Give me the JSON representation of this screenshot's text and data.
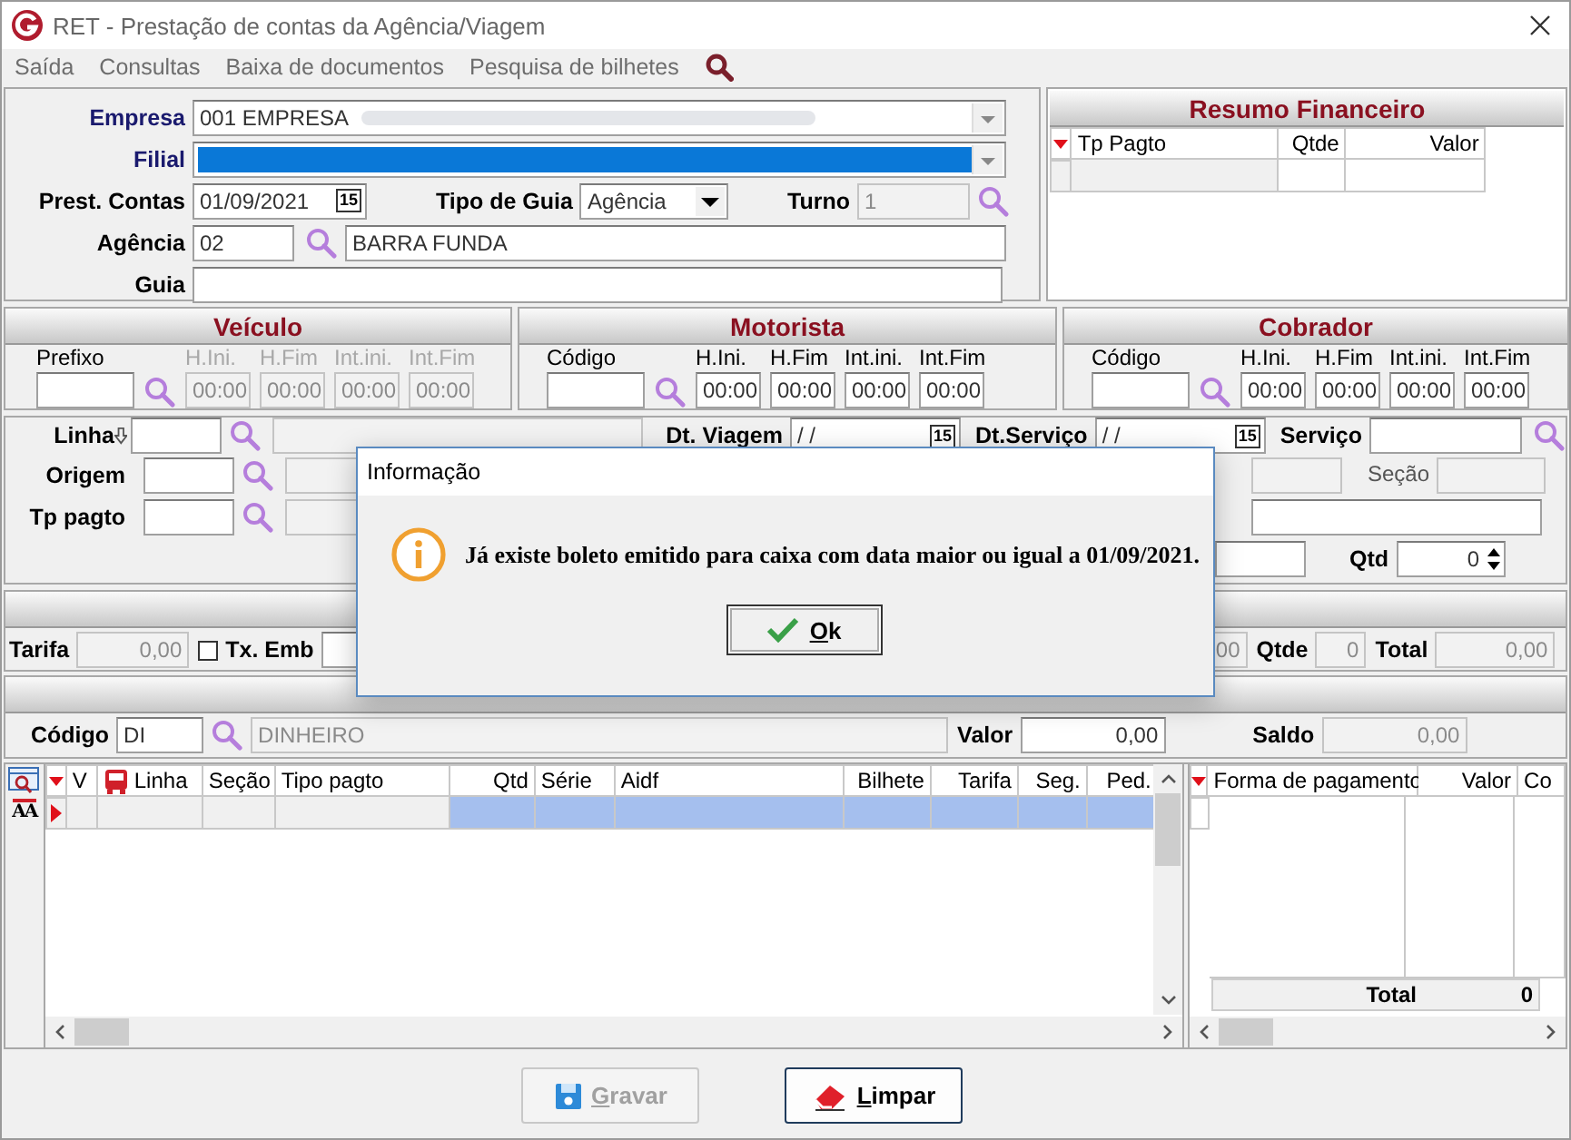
{
  "window": {
    "title": "RET - Prestação de contas da Agência/Viagem"
  },
  "menu": [
    {
      "label": "Saída"
    },
    {
      "label": "Consultas"
    },
    {
      "label": "Baixa de documentos"
    },
    {
      "label": "Pesquisa de bilhetes"
    }
  ],
  "header": {
    "empresa": {
      "label": "Empresa",
      "value": "001 EMPRESA"
    },
    "filial": {
      "label": "Filial",
      "selected": true
    },
    "prest_contas": {
      "label": "Prest. Contas",
      "value": "01/09/2021",
      "icon_text": "15"
    },
    "tipo_guia": {
      "label": "Tipo de Guia",
      "value": "Agência"
    },
    "turno": {
      "label": "Turno",
      "value": "1",
      "disabled": true
    },
    "agencia": {
      "label": "Agência",
      "code": "02",
      "name": "BARRA FUNDA"
    },
    "guia": {
      "label": "Guia"
    }
  },
  "resumo": {
    "title": "Resumo Financeiro",
    "columns": [
      {
        "label": "Tp Pagto"
      },
      {
        "label": "Qtde"
      },
      {
        "label": "Valor"
      }
    ]
  },
  "crew": [
    {
      "title": "Veículo",
      "code_label": "Prefixo",
      "times": [
        {
          "label": "H.Ini.",
          "value": "00:00",
          "disabled": true
        },
        {
          "label": "H.Fim",
          "value": "00:00",
          "disabled": true
        },
        {
          "label": "Int.ini.",
          "value": "00:00",
          "disabled": true
        },
        {
          "label": "Int.Fim",
          "value": "00:00",
          "disabled": true
        }
      ]
    },
    {
      "title": "Motorista",
      "code_label": "Código",
      "times": [
        {
          "label": "H.Ini.",
          "value": "00:00",
          "disabled": false
        },
        {
          "label": "H.Fim",
          "value": "00:00",
          "disabled": false
        },
        {
          "label": "Int.ini.",
          "value": "00:00",
          "disabled": false
        },
        {
          "label": "Int.Fim",
          "value": "00:00",
          "disabled": false
        }
      ]
    },
    {
      "title": "Cobrador",
      "code_label": "Código",
      "times": [
        {
          "label": "H.Ini.",
          "value": "00:00",
          "disabled": false
        },
        {
          "label": "H.Fim",
          "value": "00:00",
          "disabled": false
        },
        {
          "label": "Int.ini.",
          "value": "00:00",
          "disabled": false
        },
        {
          "label": "Int.Fim",
          "value": "00:00",
          "disabled": false
        }
      ]
    }
  ],
  "viagem": {
    "linha": {
      "label": "Linha"
    },
    "dt_viagem": {
      "label": "Dt. Viagem",
      "value": "/ /",
      "icon_text": "15"
    },
    "dt_servico": {
      "label": "Dt.Serviço",
      "value": "/ /",
      "icon_text": "15"
    },
    "servico": {
      "label": "Serviço"
    },
    "origem": {
      "label": "Origem"
    },
    "secao": {
      "label": "Seção"
    },
    "tp_pagto": {
      "label": "Tp pagto"
    },
    "qtd": {
      "label": "Qtd",
      "value": "0"
    }
  },
  "totais": {
    "tarifa": {
      "label": "Tarifa",
      "value": "0,00"
    },
    "tx_emb": {
      "label": "Tx. Emb",
      "checked": false
    },
    "partial_value": "00",
    "qtde": {
      "label": "Qtde",
      "value": "0"
    },
    "total": {
      "label": "Total",
      "value": "0,00"
    }
  },
  "pagamento": {
    "codigo": {
      "label": "Código",
      "code": "DI",
      "name": "DINHEIRO"
    },
    "valor": {
      "label": "Valor",
      "value": "0,00"
    },
    "saldo": {
      "label": "Saldo",
      "value": "0,00"
    }
  },
  "tools": [
    {
      "kind": "filter"
    },
    {
      "kind": "font",
      "text": "AA"
    }
  ],
  "grid": {
    "columns": [
      {
        "label": "V"
      },
      {
        "label": "Linha",
        "kind": "bus"
      },
      {
        "label": "Seção"
      },
      {
        "label": "Tipo pagto"
      },
      {
        "label": "Qtd"
      },
      {
        "label": "Série"
      },
      {
        "label": "Aidf"
      },
      {
        "label": "Bilhete"
      },
      {
        "label": "Tarifa"
      },
      {
        "label": "Seg."
      },
      {
        "label": "Ped."
      }
    ],
    "rows": [
      {
        "selected": true
      }
    ]
  },
  "payments_grid": {
    "columns": [
      {
        "label": "Forma de pagamento"
      },
      {
        "label": "Valor"
      },
      {
        "label": "Co"
      }
    ],
    "total_label": "Total",
    "total": "0"
  },
  "buttons": [
    {
      "label": "Gravar",
      "kind": "save",
      "disabled": true
    },
    {
      "label": "Limpar",
      "kind": "clear",
      "disabled": false
    }
  ],
  "dialog": {
    "title": "Informação",
    "message": "Já existe boleto emitido para caixa com data maior ou igual a 01/09/2021.",
    "button": "Ok"
  }
}
